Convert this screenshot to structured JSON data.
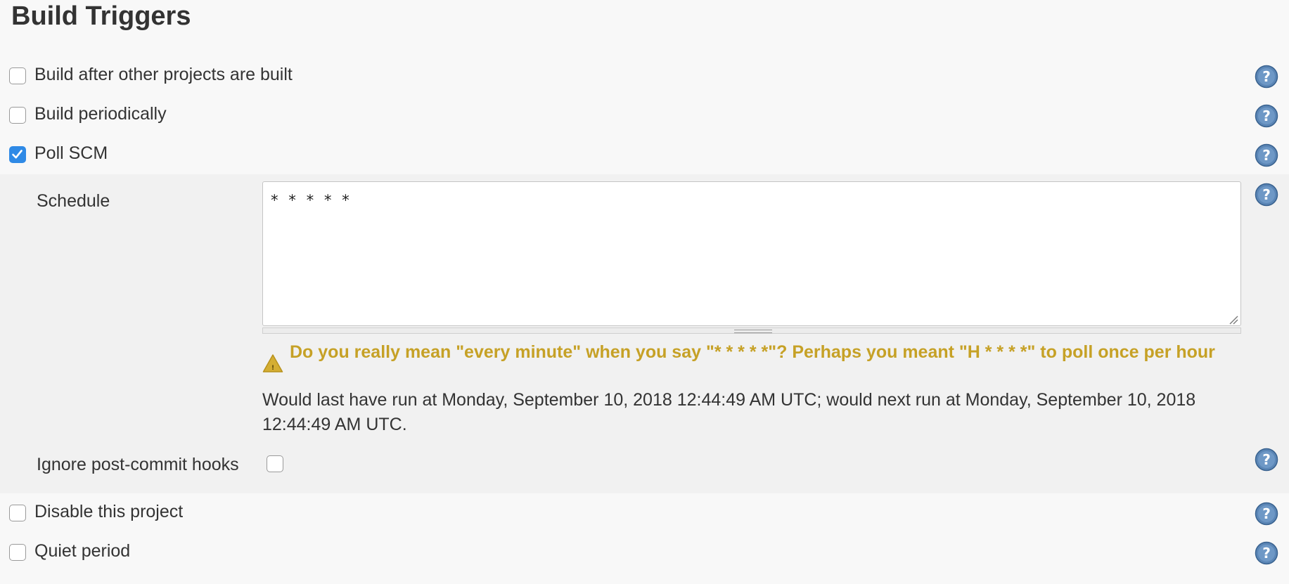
{
  "section": {
    "title": "Build Triggers"
  },
  "triggers": {
    "build_after": {
      "label": "Build after other projects are built",
      "checked": false
    },
    "build_periodically": {
      "label": "Build periodically",
      "checked": false
    },
    "poll_scm": {
      "label": "Poll SCM",
      "checked": true
    },
    "disable_project": {
      "label": "Disable this project",
      "checked": false
    },
    "quiet_period": {
      "label": "Quiet period",
      "checked": false
    }
  },
  "poll_scm": {
    "schedule_label": "Schedule",
    "schedule_value": "* * * * *",
    "warning_text": "Do you really mean \"every minute\" when you say \"* * * * *\"? Perhaps you meant \"H * * * *\" to poll once per hour",
    "info_text": "Would last have run at Monday, September 10, 2018 12:44:49 AM UTC; would next run at Monday, September 10, 2018 12:44:49 AM UTC.",
    "ignore_hooks_label": "Ignore post-commit hooks",
    "ignore_hooks_checked": false
  },
  "icons": {
    "help": "help-icon",
    "warning": "warning-icon",
    "check": "checkmark-icon"
  },
  "colors": {
    "checkbox_checked": "#2f8ae6",
    "warning_text": "#c6a126",
    "help_icon": "#4f7fb0",
    "section_background": "#f1f1f1",
    "page_background": "#f8f8f8"
  }
}
